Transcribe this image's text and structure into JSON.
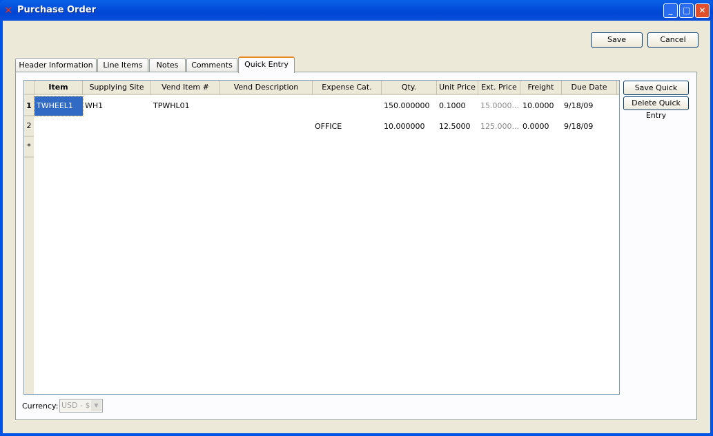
{
  "window": {
    "title": "Purchase Order"
  },
  "toolbar": {
    "save": "Save",
    "cancel": "Cancel"
  },
  "tabs": [
    "Header Information",
    "Line Items",
    "Notes",
    "Comments",
    "Quick Entry"
  ],
  "grid": {
    "columns": [
      "Item",
      "Supplying Site",
      "Vend Item #",
      "Vend Description",
      "Expense Cat.",
      "Qty.",
      "Unit Price",
      "Ext. Price",
      "Freight",
      "Due Date"
    ],
    "row_headers": [
      "1",
      "2",
      "*"
    ],
    "rows": [
      [
        "TWHEEL1",
        "WH1",
        "TPWHL01",
        "",
        "",
        "150.000000",
        "0.1000",
        "15.0000...",
        "10.0000",
        "9/18/09"
      ],
      [
        "",
        "",
        "",
        "",
        "OFFICE",
        "10.000000",
        "12.5000",
        "125.000...",
        "0.0000",
        "9/18/09"
      ]
    ]
  },
  "side": {
    "save_quick": "Save Quick Entries",
    "delete_quick": "Delete Quick Entry"
  },
  "currency": {
    "label": "Currency:",
    "value": "USD - $"
  }
}
